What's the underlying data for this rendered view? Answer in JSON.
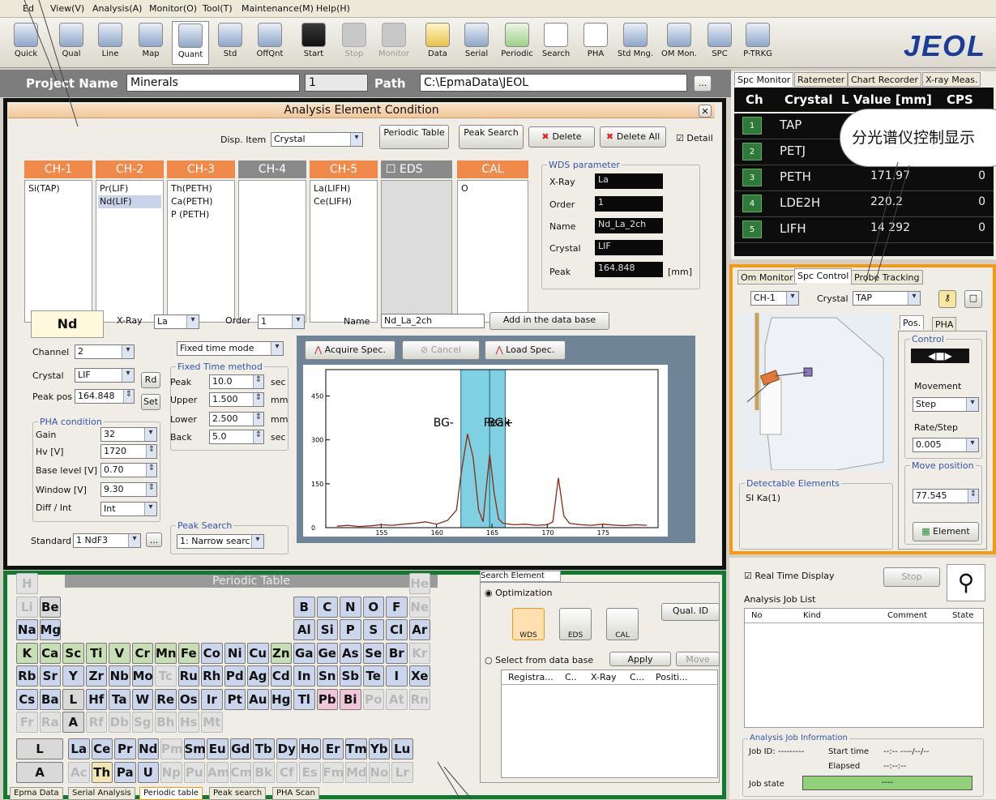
{
  "menu": [
    "Ed",
    "View(V)",
    "Analysis(A)",
    "Monitor(O)",
    "Tool(T)",
    "Maintenance(M)",
    "Help(H)"
  ],
  "toolbar": [
    "Quick",
    "Qual",
    "Line",
    "Map",
    "Quant",
    "Std",
    "OffQnt",
    "Start",
    "Stop",
    "Monitor",
    "Data",
    "Serial",
    "Periodic",
    "Search",
    "PHA",
    "Std Mng.",
    "OM Mon.",
    "SPC",
    "P-TRKG"
  ],
  "logo": "JEOL",
  "project": {
    "name_label": "Project Name",
    "name": "Minerals",
    "number": "1",
    "path_label": "Path",
    "path": "C:\\EpmaData\\JEOL",
    "browse": "..."
  },
  "aec": {
    "title": "Analysis Element Condition",
    "disp_item_label": "Disp. Item",
    "disp_item": "Crystal",
    "periodic_table_btn": "Periodic Table",
    "peak_search_btn": "Peak Search",
    "delete_btn": "Delete",
    "delete_all_btn": "Delete All",
    "detail": "Detail",
    "channels": [
      {
        "name": "CH-1",
        "items": [
          "Si(TAP)"
        ]
      },
      {
        "name": "CH-2",
        "items": [
          "Pr(LIF)",
          "Nd(LIF)"
        ]
      },
      {
        "name": "CH-3",
        "items": [
          "Th(PETH)",
          "Ca(PETH)",
          "P (PETH)"
        ]
      },
      {
        "name": "CH-4",
        "items": []
      },
      {
        "name": "CH-5",
        "items": [
          "La(LIFH)",
          "Ce(LIFH)"
        ]
      },
      {
        "name": "EDS",
        "items": []
      },
      {
        "name": "CAL",
        "items": [
          "O"
        ]
      }
    ],
    "wds": {
      "title": "WDS parameter",
      "xray_label": "X-Ray",
      "xray": "La",
      "order_label": "Order",
      "order": "1",
      "name_label": "Name",
      "name": "Nd_La_2ch",
      "crystal_label": "Crystal",
      "crystal": "LIF",
      "peak_label": "Peak",
      "peak": "164.848",
      "peak_unit": "[mm]"
    },
    "element": "Nd",
    "xray_label": "X-Ray",
    "xray": "La",
    "order_label": "Order",
    "order": "1",
    "name_label": "Name",
    "name": "Nd_La_2ch",
    "add_db": "Add in the data base",
    "channel_label": "Channel",
    "channel": "2",
    "crystal_label": "Crystal",
    "crystal": "LIF",
    "rd": "Rd",
    "peakpos_label": "Peak pos",
    "peakpos": "164.848",
    "set": "Set",
    "pha_title": "PHA condition",
    "gain_label": "Gain",
    "gain": "32",
    "hv_label": "Hv [V]",
    "hv": "1720",
    "base_label": "Base level [V]",
    "base": "0.70",
    "window_label": "Window [V]",
    "window": "9.30",
    "diff_label": "Diff / Int",
    "diff": "Int",
    "standard_label": "Standard",
    "standard": "1 NdF3",
    "std_btn": "...",
    "mode": "Fixed time mode",
    "ftm_title": "Fixed Time method",
    "ftm": [
      {
        "label": "Peak",
        "value": "10.0",
        "unit": "sec"
      },
      {
        "label": "Upper",
        "value": "1.500",
        "unit": "mm"
      },
      {
        "label": "Lower",
        "value": "2.500",
        "unit": "mm"
      },
      {
        "label": "Back",
        "value": "5.0",
        "unit": "sec"
      }
    ],
    "ps_title": "Peak Search",
    "ps": "1: Narrow searc",
    "acquire": "Acquire Spec.",
    "cancel": "Cancel",
    "load": "Load Spec.",
    "labels": {
      "bgm": "BG-",
      "peak": "Peak",
      "bgp": "BG+"
    }
  },
  "chart_data": {
    "type": "line",
    "title": "",
    "xlabel": "",
    "ylabel": "",
    "xlim": [
      150,
      180
    ],
    "ylim": [
      0,
      540
    ],
    "xticks": [
      "155",
      "160",
      "165",
      "170",
      "175"
    ],
    "yticks": [
      "0",
      "150",
      "300",
      "450"
    ],
    "bands": [
      [
        162.2,
        164.8
      ],
      [
        164.8,
        166.2
      ]
    ],
    "x": [
      151,
      152,
      153,
      154,
      155,
      156,
      157,
      158,
      159,
      160,
      161,
      161.8,
      162.2,
      162.8,
      163.3,
      163.8,
      164.2,
      164.5,
      164.8,
      165.2,
      165.6,
      166,
      167,
      168,
      169,
      170,
      170.5,
      171,
      171.5,
      172,
      173,
      174,
      175,
      176,
      177,
      178,
      179
    ],
    "y": [
      5,
      8,
      4,
      6,
      10,
      8,
      12,
      15,
      20,
      12,
      25,
      60,
      180,
      320,
      240,
      60,
      20,
      140,
      250,
      120,
      30,
      15,
      10,
      12,
      8,
      10,
      20,
      170,
      40,
      15,
      10,
      8,
      12,
      9,
      7,
      10,
      8
    ]
  },
  "periodic": {
    "title": "Periodic Table",
    "rows": [
      [
        {
          "s": "H",
          "c": "f",
          "col": 0
        },
        {
          "s": "He",
          "c": "f",
          "col": 17
        }
      ],
      [
        {
          "s": "Li",
          "c": "f",
          "col": 0
        },
        {
          "s": "Be",
          "c": "gr",
          "col": 1
        },
        {
          "s": "B",
          "c": "b",
          "col": 12
        },
        {
          "s": "C",
          "c": "b",
          "col": 13
        },
        {
          "s": "N",
          "c": "b",
          "col": 14
        },
        {
          "s": "O",
          "c": "b",
          "col": 15
        },
        {
          "s": "F",
          "c": "b",
          "col": 16
        },
        {
          "s": "Ne",
          "c": "f",
          "col": 17
        }
      ],
      [
        {
          "s": "Na",
          "c": "b",
          "col": 0
        },
        {
          "s": "Mg",
          "c": "b",
          "col": 1
        },
        {
          "s": "Al",
          "c": "b",
          "col": 12
        },
        {
          "s": "Si",
          "c": "b",
          "col": 13
        },
        {
          "s": "P",
          "c": "b",
          "col": 14
        },
        {
          "s": "S",
          "c": "b",
          "col": 15
        },
        {
          "s": "Cl",
          "c": "b",
          "col": 16
        },
        {
          "s": "Ar",
          "c": "b",
          "col": 17
        }
      ],
      [
        {
          "s": "K",
          "c": "",
          "col": 0
        },
        {
          "s": "Ca",
          "c": "",
          "col": 1
        },
        {
          "s": "Sc",
          "c": "",
          "col": 2
        },
        {
          "s": "Ti",
          "c": "",
          "col": 3
        },
        {
          "s": "V",
          "c": "",
          "col": 4
        },
        {
          "s": "Cr",
          "c": "",
          "col": 5
        },
        {
          "s": "Mn",
          "c": "",
          "col": 6
        },
        {
          "s": "Fe",
          "c": "",
          "col": 7
        },
        {
          "s": "Co",
          "c": "b",
          "col": 8
        },
        {
          "s": "Ni",
          "c": "b",
          "col": 9
        },
        {
          "s": "Cu",
          "c": "b",
          "col": 10
        },
        {
          "s": "Zn",
          "c": "",
          "col": 11
        },
        {
          "s": "Ga",
          "c": "b",
          "col": 12
        },
        {
          "s": "Ge",
          "c": "b",
          "col": 13
        },
        {
          "s": "As",
          "c": "b",
          "col": 14
        },
        {
          "s": "Se",
          "c": "b",
          "col": 15
        },
        {
          "s": "Br",
          "c": "b",
          "col": 16
        },
        {
          "s": "Kr",
          "c": "f",
          "col": 17
        }
      ],
      [
        {
          "s": "Rb",
          "c": "b",
          "col": 0
        },
        {
          "s": "Sr",
          "c": "b",
          "col": 1
        },
        {
          "s": "Y",
          "c": "b",
          "col": 2
        },
        {
          "s": "Zr",
          "c": "b",
          "col": 3
        },
        {
          "s": "Nb",
          "c": "b",
          "col": 4
        },
        {
          "s": "Mo",
          "c": "b",
          "col": 5
        },
        {
          "s": "Tc",
          "c": "f",
          "col": 6
        },
        {
          "s": "Ru",
          "c": "b",
          "col": 7
        },
        {
          "s": "Rh",
          "c": "b",
          "col": 8
        },
        {
          "s": "Pd",
          "c": "b",
          "col": 9
        },
        {
          "s": "Ag",
          "c": "b",
          "col": 10
        },
        {
          "s": "Cd",
          "c": "b",
          "col": 11
        },
        {
          "s": "In",
          "c": "b",
          "col": 12
        },
        {
          "s": "Sn",
          "c": "b",
          "col": 13
        },
        {
          "s": "Sb",
          "c": "b",
          "col": 14
        },
        {
          "s": "Te",
          "c": "b",
          "col": 15
        },
        {
          "s": "I",
          "c": "b",
          "col": 16
        },
        {
          "s": "Xe",
          "c": "b",
          "col": 17
        }
      ],
      [
        {
          "s": "Cs",
          "c": "b",
          "col": 0
        },
        {
          "s": "Ba",
          "c": "b",
          "col": 1
        },
        {
          "s": "L",
          "c": "gr",
          "col": 2
        },
        {
          "s": "Hf",
          "c": "b",
          "col": 3
        },
        {
          "s": "Ta",
          "c": "b",
          "col": 4
        },
        {
          "s": "W",
          "c": "b",
          "col": 5
        },
        {
          "s": "Re",
          "c": "b",
          "col": 6
        },
        {
          "s": "Os",
          "c": "b",
          "col": 7
        },
        {
          "s": "Ir",
          "c": "b",
          "col": 8
        },
        {
          "s": "Pt",
          "c": "b",
          "col": 9
        },
        {
          "s": "Au",
          "c": "b",
          "col": 10
        },
        {
          "s": "Hg",
          "c": "b",
          "col": 11
        },
        {
          "s": "Tl",
          "c": "b",
          "col": 12
        },
        {
          "s": "Pb",
          "c": "p",
          "col": 13
        },
        {
          "s": "Bi",
          "c": "p",
          "col": 14
        },
        {
          "s": "Po",
          "c": "f",
          "col": 15
        },
        {
          "s": "At",
          "c": "f",
          "col": 16
        },
        {
          "s": "Rn",
          "c": "f",
          "col": 17
        }
      ],
      [
        {
          "s": "Fr",
          "c": "f",
          "col": 0
        },
        {
          "s": "Ra",
          "c": "f",
          "col": 1
        },
        {
          "s": "A",
          "c": "gr",
          "col": 2
        },
        {
          "s": "Rf",
          "c": "f",
          "col": 3
        },
        {
          "s": "Db",
          "c": "f",
          "col": 4
        },
        {
          "s": "Sg",
          "c": "f",
          "col": 5
        },
        {
          "s": "Bh",
          "c": "f",
          "col": 6
        },
        {
          "s": "Hs",
          "c": "f",
          "col": 7
        },
        {
          "s": "Mt",
          "c": "f",
          "col": 8
        }
      ]
    ],
    "lanth_label": "L",
    "lanth": [
      {
        "s": "La",
        "c": "b"
      },
      {
        "s": "Ce",
        "c": "b"
      },
      {
        "s": "Pr",
        "c": "b"
      },
      {
        "s": "Nd",
        "c": "b"
      },
      {
        "s": "Pm",
        "c": "f"
      },
      {
        "s": "Sm",
        "c": "b"
      },
      {
        "s": "Eu",
        "c": "b"
      },
      {
        "s": "Gd",
        "c": "b"
      },
      {
        "s": "Tb",
        "c": "b"
      },
      {
        "s": "Dy",
        "c": "b"
      },
      {
        "s": "Ho",
        "c": "b"
      },
      {
        "s": "Er",
        "c": "b"
      },
      {
        "s": "Tm",
        "c": "b"
      },
      {
        "s": "Yb",
        "c": "b"
      },
      {
        "s": "Lu",
        "c": "b"
      }
    ],
    "act_label": "A",
    "act": [
      {
        "s": "Ac",
        "c": "f"
      },
      {
        "s": "Th",
        "c": "y"
      },
      {
        "s": "Pa",
        "c": "b"
      },
      {
        "s": "U",
        "c": "b"
      },
      {
        "s": "Np",
        "c": "f"
      },
      {
        "s": "Pu",
        "c": "f"
      },
      {
        "s": "Am",
        "c": "f"
      },
      {
        "s": "Cm",
        "c": "f"
      },
      {
        "s": "Bk",
        "c": "f"
      },
      {
        "s": "Cf",
        "c": "f"
      },
      {
        "s": "Es",
        "c": "f"
      },
      {
        "s": "Fm",
        "c": "f"
      },
      {
        "s": "Md",
        "c": "f"
      },
      {
        "s": "No",
        "c": "f"
      },
      {
        "s": "Lr",
        "c": "f"
      }
    ]
  },
  "search": {
    "tabs": [
      "Search",
      "Element"
    ],
    "optimization": "Optimization",
    "wds": "WDS",
    "eds": "EDS",
    "cal": "CAL",
    "qual_id": "Qual. ID",
    "select_db": "Select from data base",
    "apply": "Apply",
    "move": "Move",
    "cols": [
      "Registra...",
      "C..",
      "X-Ray",
      "C...",
      "Positi..."
    ]
  },
  "bottom_tabs": [
    "Epma Data",
    "Serial Analysis",
    "Periodic table",
    "Peak search",
    "PHA Scan"
  ],
  "spc_monitor": {
    "tabs": [
      "Spc Monitor",
      "Ratemeter",
      "Chart Recorder",
      "X-ray Meas."
    ],
    "headers": [
      "Ch",
      "Crystal",
      "L Value [mm]",
      "CPS"
    ],
    "rows": [
      {
        "ch": "1",
        "crystal": "TAP",
        "lval": "",
        "cps": ""
      },
      {
        "ch": "2",
        "crystal": "PETJ",
        "lval": "",
        "cps": ""
      },
      {
        "ch": "3",
        "crystal": "PETH",
        "lval": "171.97",
        "cps": "0"
      },
      {
        "ch": "4",
        "crystal": "LDE2H",
        "lval": "220.2",
        "cps": "0"
      },
      {
        "ch": "5",
        "crystal": "LIFH",
        "lval": "14 292",
        "cps": "0"
      }
    ]
  },
  "callout": "分光谱仪控制显示",
  "spc_control": {
    "tabs": [
      "Om Monitor",
      "Spc Control",
      "Probe Tracking"
    ],
    "ch": "CH-1",
    "crystal_label": "Crystal",
    "crystal": "TAP",
    "subtabs": [
      "Pos.",
      "PHA"
    ],
    "control": "Control",
    "movement_label": "Movement",
    "movement": "Step",
    "ratestep_label": "Rate/Step",
    "ratestep": "0.005",
    "move_label": "Move position",
    "move": "77.545",
    "element_btn": "Element",
    "detectable_label": "Detectable Elements",
    "detectable": "SI Ka(1)"
  },
  "jobs": {
    "realtime": "Real Time Display",
    "stop": "Stop",
    "job_list": "Analysis Job List",
    "cols": [
      "No",
      "Kind",
      "Comment",
      "State"
    ],
    "info_title": "Analysis Job Information",
    "jobid_label": "Job ID:",
    "jobid": "---------",
    "start_label": "Start time",
    "start": "--:-- ----/--/--",
    "elapsed_label": "Elapsed",
    "elapsed": "--:--:--",
    "state_label": "Job state",
    "state": "----"
  }
}
